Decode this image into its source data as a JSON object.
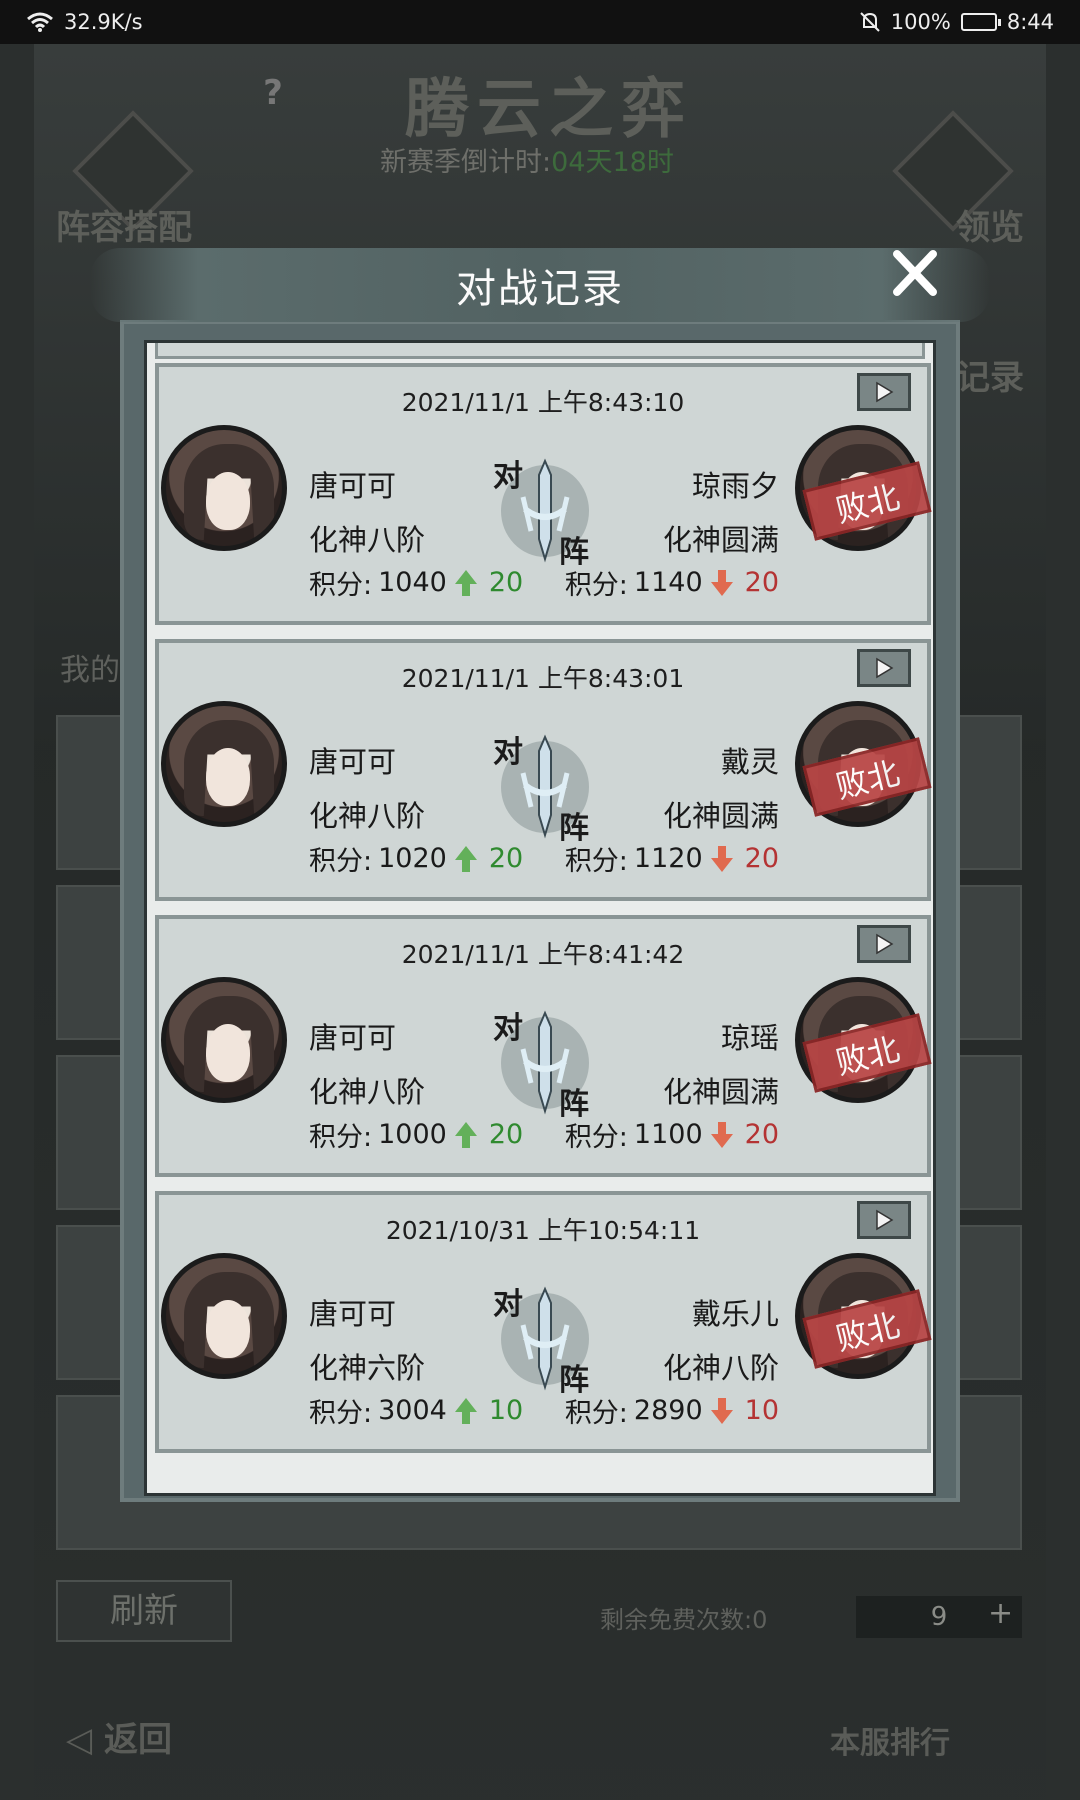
{
  "status_bar": {
    "network_speed": "32.9K/s",
    "battery_percent": "100%",
    "time": "8:44",
    "icons": [
      "wifi-icon",
      "mute-icon",
      "battery-icon"
    ]
  },
  "background": {
    "title": "腾云之弈",
    "help": "?",
    "countdown_label": "新赛季倒计时:",
    "countdown_value": "04天18时",
    "lineup_label": "阵容搭配",
    "preview_label": "领览",
    "record_label": "记录",
    "my_rank_label": "我的",
    "refresh_label": "刷新",
    "free_times_label": "剩余免费次数:0",
    "ticket_count": "9",
    "back_label": "返回",
    "server_rank_label": "本服排行"
  },
  "modal": {
    "title": "对战记录",
    "vs_chars": [
      "对",
      "阵"
    ],
    "score_prefix": "积分:",
    "defeat_label": "败北",
    "records": [
      {
        "time": "2021/11/1 上午8:43:10",
        "left": {
          "name": "唐可可",
          "rank": "化神八阶",
          "score": "1040",
          "delta": "20"
        },
        "right": {
          "name": "琼雨夕",
          "rank": "化神圆满",
          "score": "1140",
          "delta": "20"
        }
      },
      {
        "time": "2021/11/1 上午8:43:01",
        "left": {
          "name": "唐可可",
          "rank": "化神八阶",
          "score": "1020",
          "delta": "20"
        },
        "right": {
          "name": "戴灵",
          "rank": "化神圆满",
          "score": "1120",
          "delta": "20"
        }
      },
      {
        "time": "2021/11/1 上午8:41:42",
        "left": {
          "name": "唐可可",
          "rank": "化神八阶",
          "score": "1000",
          "delta": "20"
        },
        "right": {
          "name": "琼瑶",
          "rank": "化神圆满",
          "score": "1100",
          "delta": "20"
        }
      },
      {
        "time": "2021/10/31 上午10:54:11",
        "left": {
          "name": "唐可可",
          "rank": "化神六阶",
          "score": "3004",
          "delta": "10"
        },
        "right": {
          "name": "戴乐儿",
          "rank": "化神八阶",
          "score": "2890",
          "delta": "10"
        }
      }
    ]
  },
  "colors": {
    "up": "#2f8a2f",
    "down": "#b43333",
    "defeat": "#b84545",
    "card_bg": "#cfd6d5"
  }
}
